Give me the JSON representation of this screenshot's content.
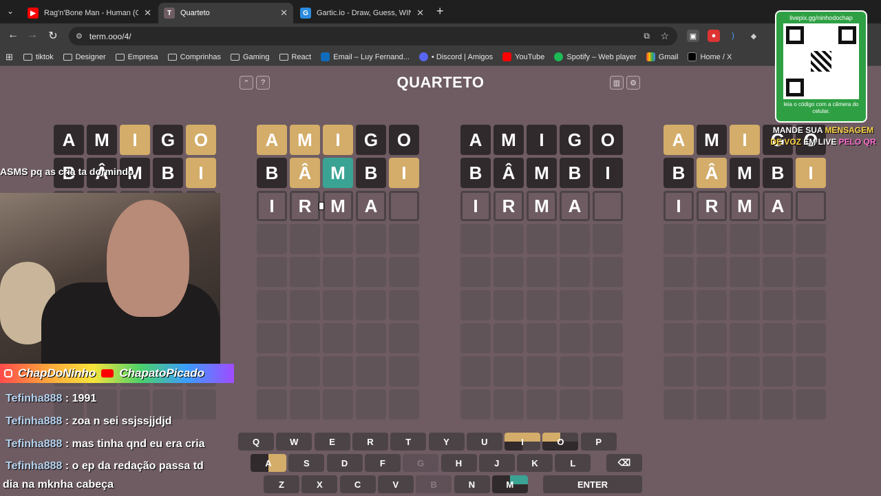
{
  "browser": {
    "tabs": [
      {
        "title": "Rag'n'Bone Man - Human (Offic",
        "active": false,
        "icon": "youtube-icon"
      },
      {
        "title": "Quarteto",
        "active": true,
        "icon": "term-icon"
      },
      {
        "title": "Gartic.io - Draw, Guess, WIN",
        "active": false,
        "icon": "gartic-icon"
      }
    ],
    "new_tab": "+",
    "url": "term.ooo/4/",
    "bookmarks": [
      "tiktok",
      "Designer",
      "Empresa",
      "Comprinhas",
      "Gaming",
      "React",
      "Email – Luy Fernand...",
      "• Discord | Amigos",
      "YouTube",
      "Spotify – Web player",
      "Gmail",
      "Home / X"
    ]
  },
  "game": {
    "title": "QUARTETO",
    "help": "?",
    "boards": [
      {
        "rows": [
          [
            [
              "A",
              "gray"
            ],
            [
              "M",
              "gray"
            ],
            [
              "I",
              "yellow"
            ],
            [
              "G",
              "gray"
            ],
            [
              "O",
              "yellow"
            ]
          ],
          [
            [
              "B",
              "gray"
            ],
            [
              "Â",
              "gray"
            ],
            [
              "M",
              "gray"
            ],
            [
              "B",
              "gray"
            ],
            [
              "I",
              "yellow"
            ]
          ],
          [
            [
              "I",
              "cur"
            ],
            [
              "R",
              "cur"
            ],
            [
              "M",
              "cur"
            ],
            [
              "A",
              "cur"
            ],
            [
              "",
              "cur"
            ]
          ]
        ]
      },
      {
        "rows": [
          [
            [
              "A",
              "yellow"
            ],
            [
              "M",
              "yellow"
            ],
            [
              "I",
              "yellow"
            ],
            [
              "G",
              "gray"
            ],
            [
              "O",
              "gray"
            ]
          ],
          [
            [
              "B",
              "gray"
            ],
            [
              "Â",
              "yellow"
            ],
            [
              "M",
              "green"
            ],
            [
              "B",
              "gray"
            ],
            [
              "I",
              "yellow"
            ]
          ],
          [
            [
              "I",
              "cur"
            ],
            [
              "R",
              "cur"
            ],
            [
              "M",
              "cur"
            ],
            [
              "A",
              "cur"
            ],
            [
              "",
              "cur"
            ]
          ]
        ]
      },
      {
        "rows": [
          [
            [
              "A",
              "gray"
            ],
            [
              "M",
              "gray"
            ],
            [
              "I",
              "gray"
            ],
            [
              "G",
              "gray"
            ],
            [
              "O",
              "gray"
            ]
          ],
          [
            [
              "B",
              "gray"
            ],
            [
              "Â",
              "gray"
            ],
            [
              "M",
              "gray"
            ],
            [
              "B",
              "gray"
            ],
            [
              "I",
              "gray"
            ]
          ],
          [
            [
              "I",
              "cur"
            ],
            [
              "R",
              "cur"
            ],
            [
              "M",
              "cur"
            ],
            [
              "A",
              "cur"
            ],
            [
              "",
              "cur"
            ]
          ]
        ]
      },
      {
        "rows": [
          [
            [
              "A",
              "yellow"
            ],
            [
              "M",
              "gray"
            ],
            [
              "I",
              "yellow"
            ],
            [
              "G",
              "gray"
            ],
            [
              "O",
              "gray"
            ]
          ],
          [
            [
              "B",
              "gray"
            ],
            [
              "Â",
              "yellow"
            ],
            [
              "M",
              "gray"
            ],
            [
              "B",
              "gray"
            ],
            [
              "I",
              "yellow"
            ]
          ],
          [
            [
              "I",
              "cur"
            ],
            [
              "R",
              "cur"
            ],
            [
              "M",
              "cur"
            ],
            [
              "A",
              "cur"
            ],
            [
              "",
              "cur"
            ]
          ]
        ]
      }
    ],
    "keyboard": {
      "row1": [
        "Q",
        "W",
        "E",
        "R",
        "T",
        "Y",
        "U",
        "I",
        "O",
        "P"
      ],
      "row2": [
        "A",
        "S",
        "D",
        "F",
        "G",
        "H",
        "J",
        "K",
        "L"
      ],
      "row3": [
        "Z",
        "X",
        "C",
        "V",
        "B",
        "N",
        "M"
      ],
      "enter": "ENTER",
      "backspace": "⌫"
    }
  },
  "overlay": {
    "chat_top": "ASMS pq as cria ta dormindo",
    "socials": [
      "ChapDoNinho",
      "ChapatoPicado"
    ],
    "chat": [
      {
        "user": "Tefinha888",
        "msg": " : 1991"
      },
      {
        "user": "Tefinha888",
        "msg": " : zoa n sei ssjssjjdjd"
      },
      {
        "user": "Tefinha888",
        "msg": " : mas tinha qnd eu era cria"
      },
      {
        "user": "Tefinha888",
        "msg": " : o ep da redação passa td"
      }
    ],
    "chat_wrap": "dia na mknha cabeça",
    "qr_url": "livepix.gg/ninhodochap",
    "qr_note": "leia o código com a câmera do celular.",
    "voice_1": "MANDE SUA ",
    "voice_2": "MENSAGEM",
    "voice_3": "DE VOZ",
    "voice_4": " EM LIVE ",
    "voice_5": "PELO QR"
  }
}
